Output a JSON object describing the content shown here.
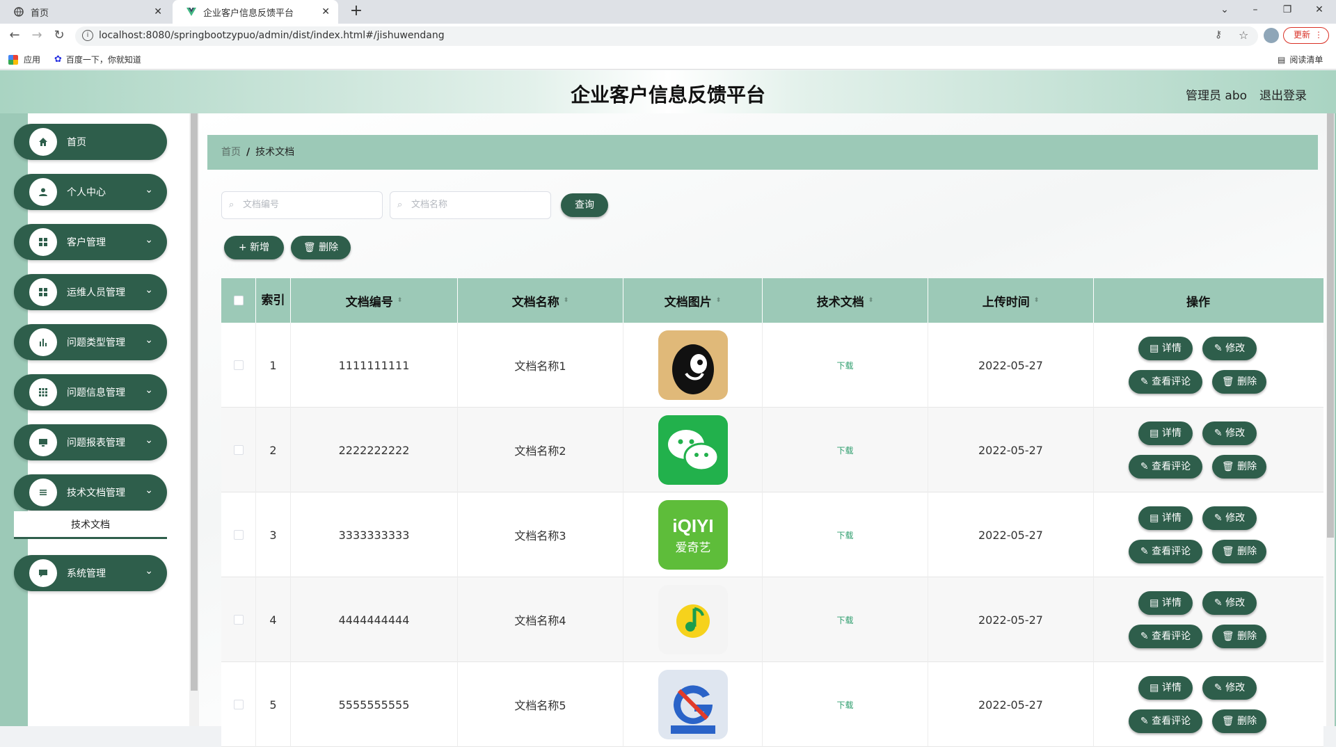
{
  "browser": {
    "tabs": [
      {
        "title": "首页",
        "icon": "globe-icon"
      },
      {
        "title": "企业客户信息反馈平台",
        "icon": "vue-logo-icon"
      }
    ],
    "url": "localhost:8080/springbootzypuo/admin/dist/index.html#/jishuwendang",
    "update_label": "更新",
    "bookmarks": {
      "apps": "应用",
      "baidu": "百度一下，你就知道",
      "reading_list": "阅读清单"
    }
  },
  "header": {
    "title": "企业客户信息反馈平台",
    "admin_label": "管理员 abo",
    "logout_label": "退出登录"
  },
  "sidebar": {
    "items": [
      {
        "label": "首页",
        "icon": "home-icon",
        "has_children": false
      },
      {
        "label": "个人中心",
        "icon": "user-icon",
        "has_children": true
      },
      {
        "label": "客户管理",
        "icon": "grid-icon",
        "has_children": true
      },
      {
        "label": "运维人员管理",
        "icon": "grid-icon",
        "has_children": true
      },
      {
        "label": "问题类型管理",
        "icon": "bar-chart-icon",
        "has_children": true
      },
      {
        "label": "问题信息管理",
        "icon": "apps-icon",
        "has_children": true
      },
      {
        "label": "问题报表管理",
        "icon": "monitor-icon",
        "has_children": true
      },
      {
        "label": "技术文档管理",
        "icon": "list-icon",
        "has_children": true
      },
      {
        "label": "系统管理",
        "icon": "chat-icon",
        "has_children": true
      }
    ],
    "active_submenu": "技术文档"
  },
  "breadcrumb": {
    "home": "首页",
    "separator": "/",
    "current": "技术文档"
  },
  "search": {
    "code_placeholder": "文档编号",
    "name_placeholder": "文档名称",
    "query_label": "查询"
  },
  "toolbar": {
    "add_label": "+ 新增",
    "delete_label": "删除"
  },
  "table": {
    "columns": [
      "索引",
      "文档编号",
      "文档名称",
      "文档图片",
      "技术文档",
      "上传时间",
      "操作"
    ],
    "rows": [
      {
        "index": "1",
        "code": "1111111111",
        "name": "文档名称1",
        "image": "penguin-app-icon",
        "doc": "下载",
        "time": "2022-05-27"
      },
      {
        "index": "2",
        "code": "2222222222",
        "name": "文档名称2",
        "image": "wechat-icon",
        "doc": "下载",
        "time": "2022-05-27"
      },
      {
        "index": "3",
        "code": "3333333333",
        "name": "文档名称3",
        "image": "iqiyi-icon",
        "doc": "下载",
        "time": "2022-05-27"
      },
      {
        "index": "4",
        "code": "4444444444",
        "name": "文档名称4",
        "image": "qq-music-icon",
        "doc": "下载",
        "time": "2022-05-27"
      },
      {
        "index": "5",
        "code": "5555555555",
        "name": "文档名称5",
        "image": "tencent-games-icon",
        "doc": "下载",
        "time": "2022-05-27"
      }
    ],
    "actions": {
      "detail": "详情",
      "edit": "修改",
      "comments": "查看评论",
      "delete": "删除"
    },
    "iqiyi_text": {
      "logo": "iQIYI",
      "cn": "爱奇艺"
    }
  },
  "colors": {
    "primary": "#2e5e4b",
    "accent": "#9cc9b7",
    "link": "#2e9e6d"
  }
}
